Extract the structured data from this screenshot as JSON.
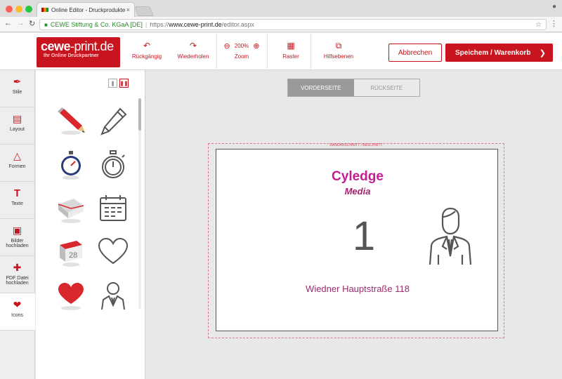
{
  "browser": {
    "tab_title": "Online Editor - Druckprodukte",
    "tab_close": "×",
    "url_org": "CEWE Stiftung & Co. KGaA [DE]",
    "url_separator": "|",
    "url_scheme": "https://",
    "url_host": "www.cewe-print.de",
    "url_path": "/editor.aspx",
    "icons": [
      "back-icon",
      "forward-icon",
      "reload-icon",
      "lock-icon",
      "star-icon",
      "menu-icon",
      "profile-icon"
    ]
  },
  "logo": {
    "brand_bold": "cewe",
    "brand_rest": "-print.de",
    "tagline": "Ihr Online Druckpartner"
  },
  "toolbar": {
    "undo_label": "Rückgängig",
    "redo_label": "Wiederholen",
    "zoom_value": "200%",
    "zoom_label": "Zoom",
    "grid_label": "Raster",
    "guides_label": "Hilfsebenen",
    "cancel_label": "Abbrechen",
    "save_label": "Speichem / Warenkorb"
  },
  "sidebar": {
    "items": [
      {
        "label": "Stile",
        "icon": "brush-icon"
      },
      {
        "label": "Layout",
        "icon": "layout-icon"
      },
      {
        "label": "Formen",
        "icon": "shapes-icon"
      },
      {
        "label": "Texte",
        "icon": "text-icon"
      },
      {
        "label": "Bilder hochladen",
        "icon": "image-upload-icon"
      },
      {
        "label": "PDF Datei hochladen",
        "icon": "pdf-icon"
      },
      {
        "label": "Icons",
        "icon": "icons-icon",
        "active": true
      }
    ]
  },
  "icon_panel": {
    "icons": [
      "pencil-3d-icon",
      "pen-outline-icon",
      "stopwatch-3d-icon",
      "stopwatch-outline-icon",
      "envelope-3d-icon",
      "calendar-outline-icon",
      "calendar-3d-icon",
      "heart-outline-icon",
      "heart-3d-icon",
      "businessman-outline-icon"
    ],
    "calendar_3d_day": "28"
  },
  "canvas": {
    "tab_front": "VORDERSEITE",
    "tab_back": "RÜCKSEITE",
    "bleed_label": "RANDANSCHNITT / BESCHNITT",
    "company_name": "Cyledge",
    "company_sub": "Media",
    "big_number": "1",
    "address": "Wiedner Hauptstraße 118",
    "person_icon": "businessman-icon"
  },
  "colors": {
    "brand_red": "#c8141e",
    "company_magenta": "#c31d96",
    "address_purple": "#9b2a6e"
  }
}
